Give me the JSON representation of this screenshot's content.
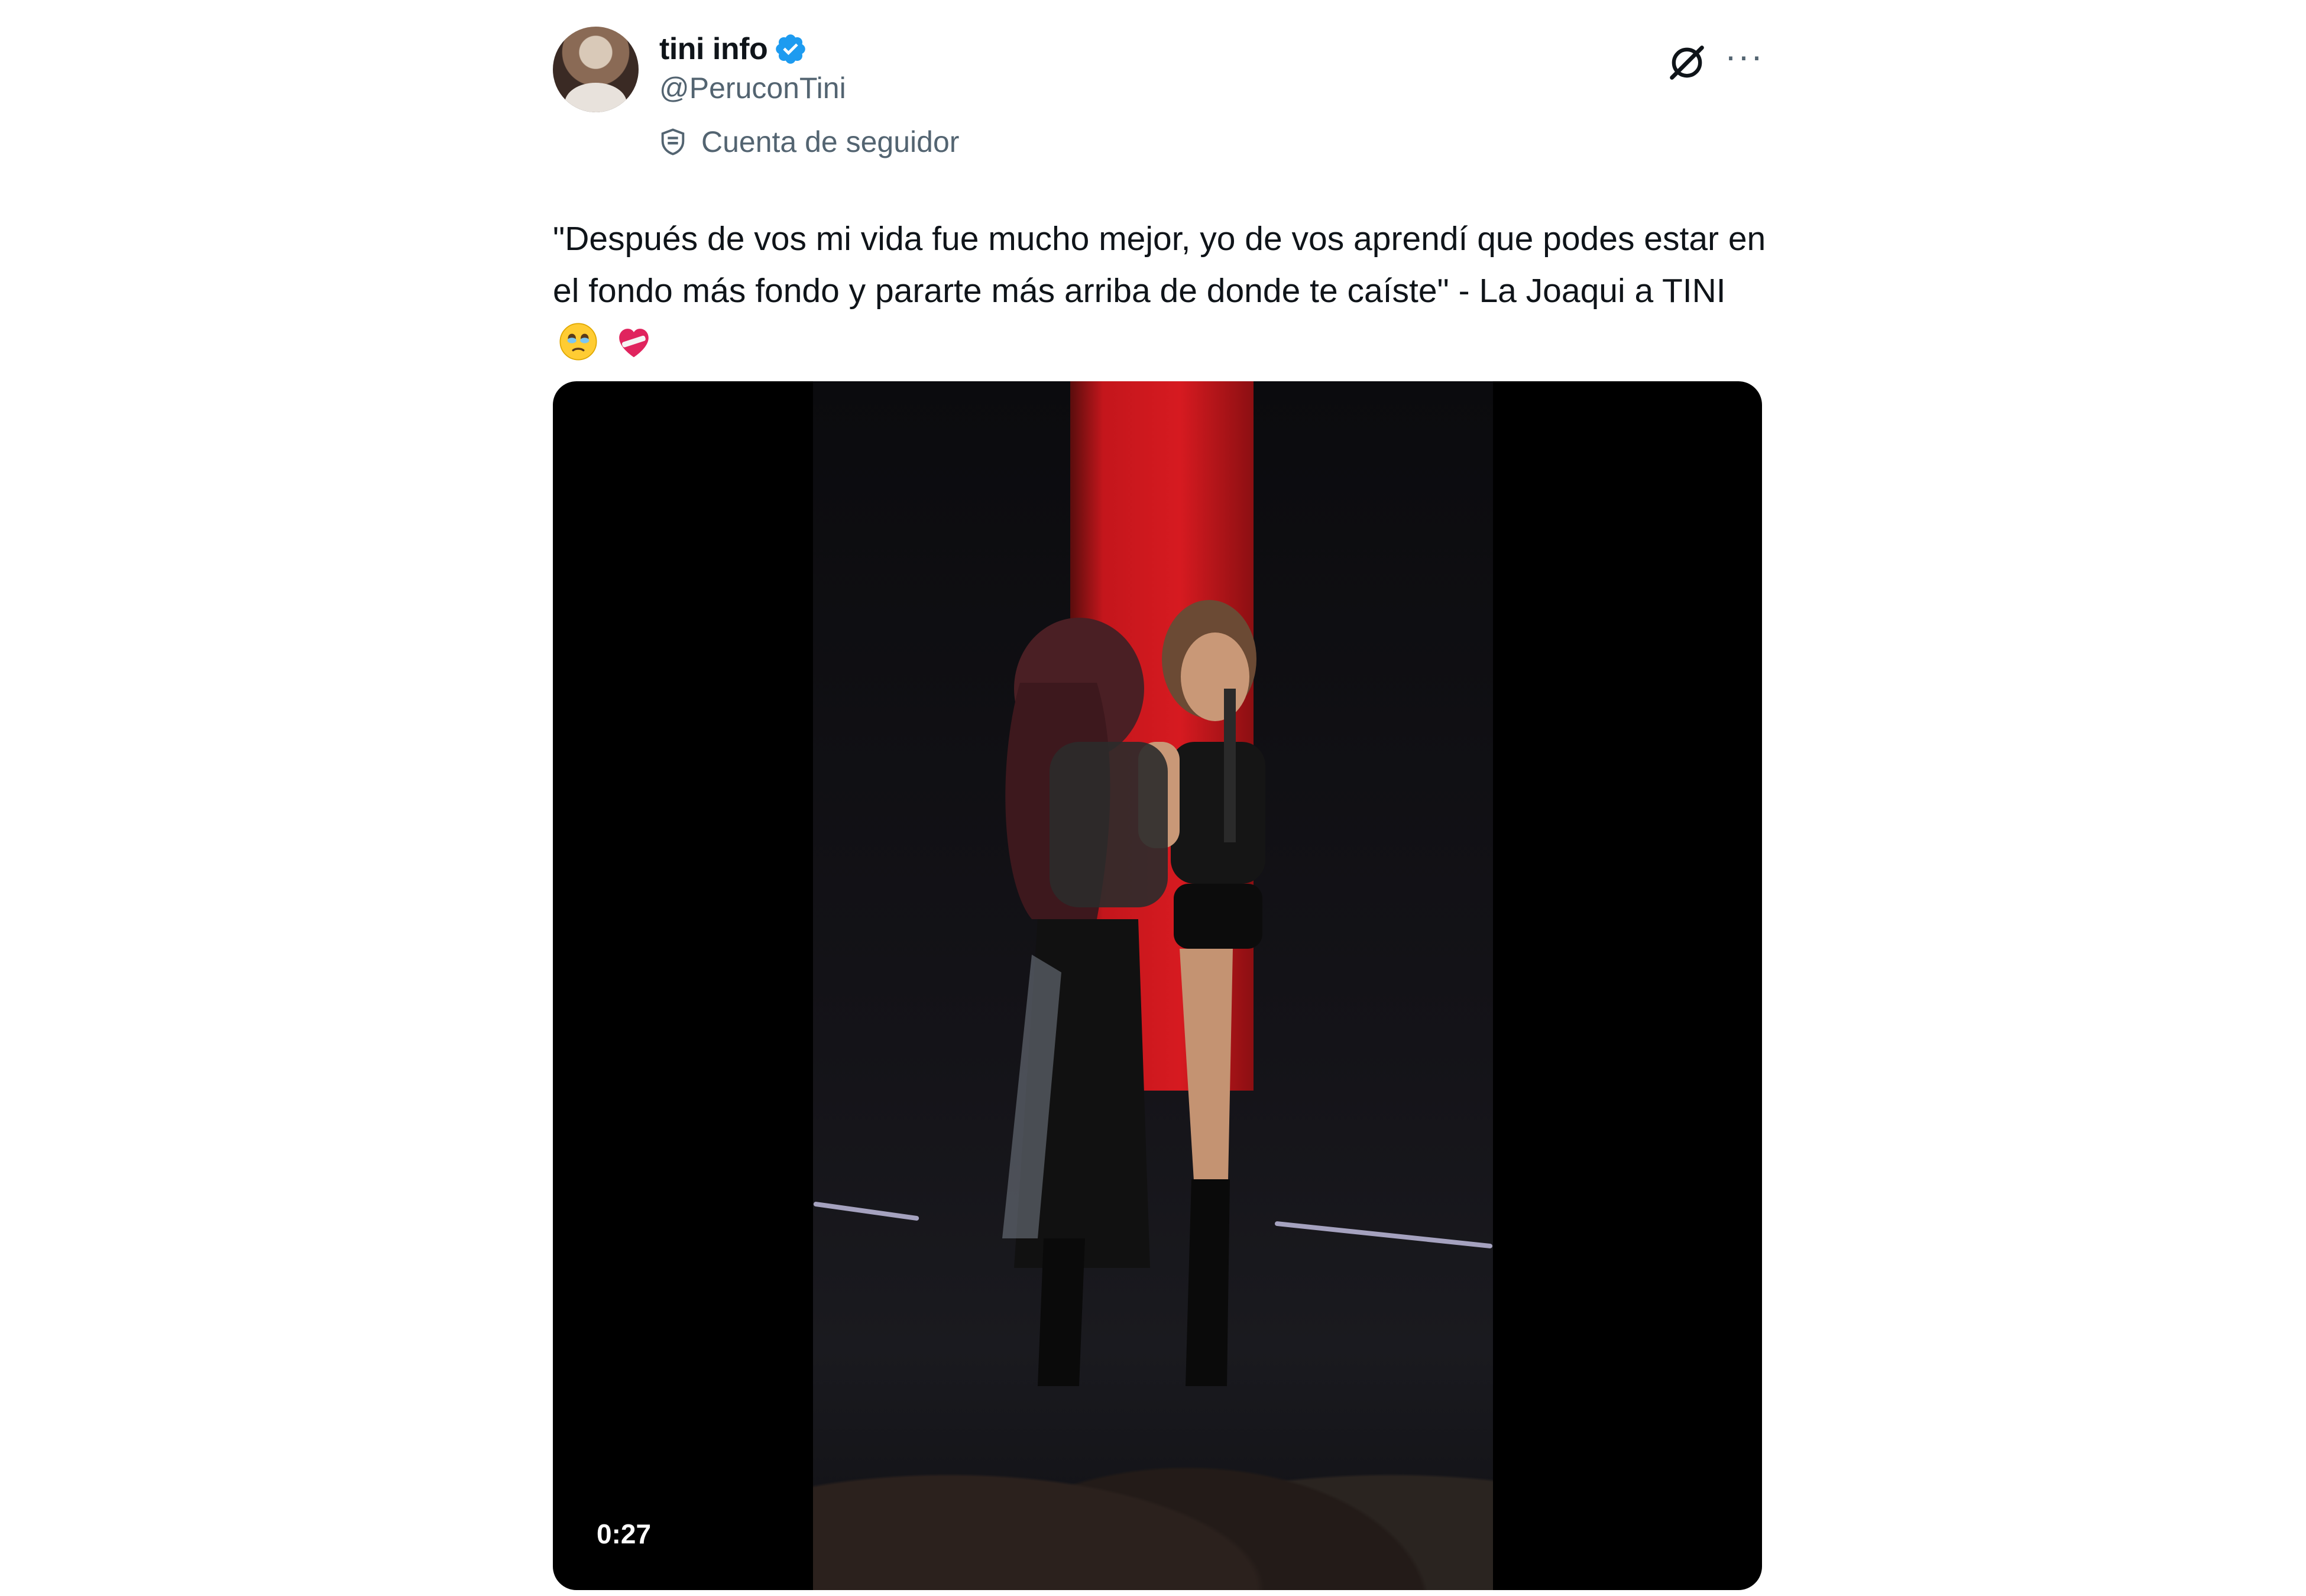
{
  "author": {
    "display_name": "tini info",
    "handle": "@PeruconTini",
    "account_label": "Cuenta de seguidor",
    "verified": true
  },
  "tweet": {
    "text": "\"Después de vos mi vida fue mucho mejor, yo de vos aprendí que podes estar en el fondo más fondo y pararte más arriba de donde te caíste\" - La Joaqui a TINI",
    "emojis": [
      "face-holding-back-tears",
      "mending-heart"
    ]
  },
  "media": {
    "type": "video",
    "duration": "0:27"
  },
  "icons": {
    "verified": "verified-badge-icon",
    "grok": "grok-icon",
    "more": "more-icon",
    "account": "shield-icon"
  },
  "colors": {
    "text_primary": "#0f1419",
    "text_secondary": "#536471",
    "verified_blue": "#1d9bf0"
  }
}
